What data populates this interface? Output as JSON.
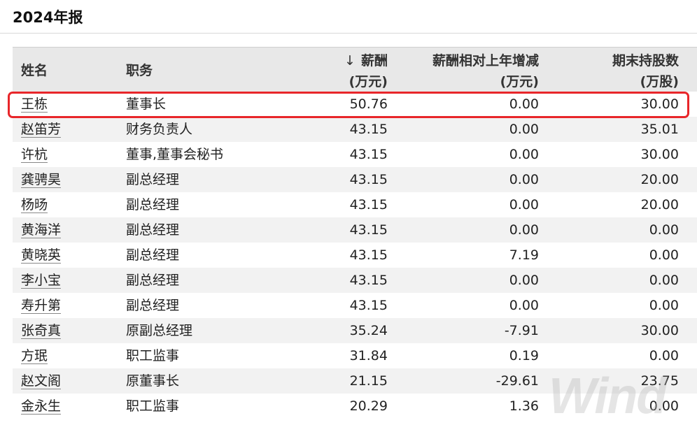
{
  "header": {
    "title": "2024年报"
  },
  "table": {
    "columns": {
      "name": "姓名",
      "role": "职务",
      "salary_line1": "薪酬",
      "salary_line2": "(万元)",
      "sort_arrow": "↓",
      "change_line1": "薪酬相对上年增减",
      "change_line2": "(万元)",
      "shares_line1": "期末持股数",
      "shares_line2": "(万股)"
    },
    "rows": [
      {
        "name": "王栋",
        "role": "董事长",
        "salary": "50.76",
        "change": "0.00",
        "shares": "30.00"
      },
      {
        "name": "赵笛芳",
        "role": "财务负责人",
        "salary": "43.15",
        "change": "0.00",
        "shares": "35.01"
      },
      {
        "name": "许杭",
        "role": "董事,董事会秘书",
        "salary": "43.15",
        "change": "0.00",
        "shares": "30.00"
      },
      {
        "name": "龚骋昊",
        "role": "副总经理",
        "salary": "43.15",
        "change": "0.00",
        "shares": "20.00"
      },
      {
        "name": "杨旸",
        "role": "副总经理",
        "salary": "43.15",
        "change": "0.00",
        "shares": "20.00"
      },
      {
        "name": "黄海洋",
        "role": "副总经理",
        "salary": "43.15",
        "change": "0.00",
        "shares": "0.00"
      },
      {
        "name": "黄晓英",
        "role": "副总经理",
        "salary": "43.15",
        "change": "7.19",
        "shares": "0.00"
      },
      {
        "name": "李小宝",
        "role": "副总经理",
        "salary": "43.15",
        "change": "0.00",
        "shares": "0.00"
      },
      {
        "name": "寿升第",
        "role": "副总经理",
        "salary": "43.15",
        "change": "0.00",
        "shares": "0.00"
      },
      {
        "name": "张奇真",
        "role": "原副总经理",
        "salary": "35.24",
        "change": "-7.91",
        "shares": "30.00"
      },
      {
        "name": "方珉",
        "role": "职工监事",
        "salary": "31.84",
        "change": "0.19",
        "shares": "0.00"
      },
      {
        "name": "赵文阁",
        "role": "原董事长",
        "salary": "21.15",
        "change": "-29.61",
        "shares": "23.75"
      },
      {
        "name": "金永生",
        "role": "职工监事",
        "salary": "20.29",
        "change": "1.36",
        "shares": "0.00"
      }
    ]
  },
  "watermark": "Wind",
  "colors": {
    "highlight": "#e8262a",
    "header_bg": "#e8e8e8",
    "alt_row_bg": "#f2f2f2"
  }
}
